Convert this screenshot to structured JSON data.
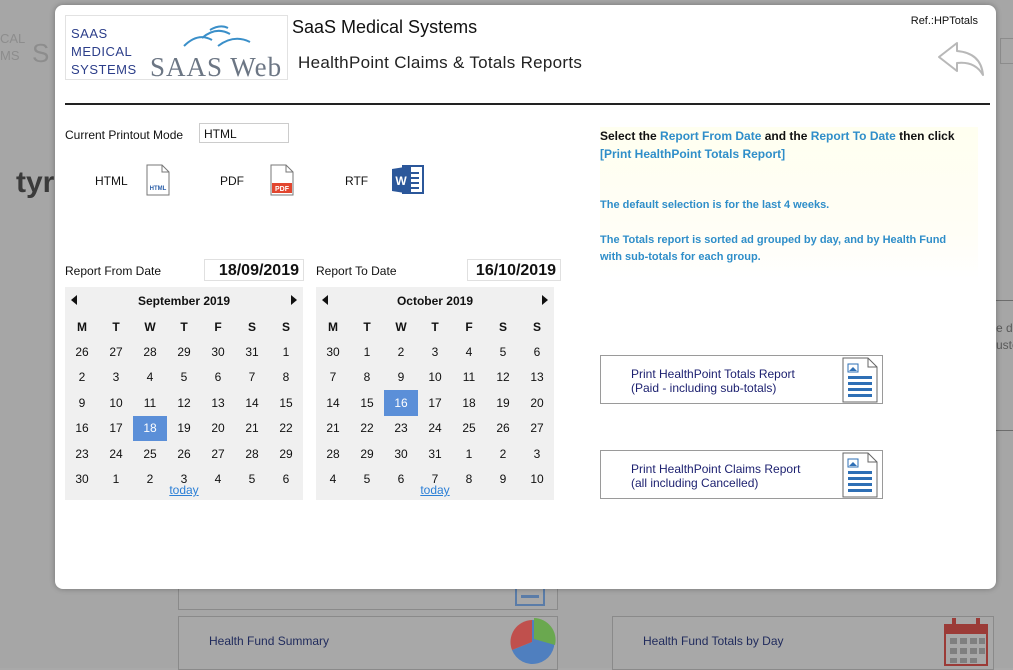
{
  "background": {
    "logo_line1": "CAL",
    "logo_line2": "MS",
    "logo_big": "S",
    "brand_partial": "tyr",
    "right_text_line1": "e d",
    "right_text_line2": "uste",
    "cards": [
      {
        "label": "Health Fund Summary"
      },
      {
        "label": "Health Fund Totals by Day"
      }
    ]
  },
  "header": {
    "logo_lines": [
      "SAAS",
      "MEDICAL",
      "SYSTEMS"
    ],
    "logo_web": "SAAS Web",
    "app_title": "SaaS Medical Systems",
    "report_title": "HealthPoint Claims & Totals Reports",
    "ref": "Ref.:HPTotals"
  },
  "printout": {
    "mode_label": "Current Printout Mode",
    "mode_value": "HTML",
    "formats": [
      {
        "label": "HTML",
        "icon": "html-file-icon"
      },
      {
        "label": "PDF",
        "icon": "pdf-file-icon"
      },
      {
        "label": "RTF",
        "icon": "word-file-icon"
      }
    ]
  },
  "from": {
    "label": "Report From Date",
    "value": "18/09/2019",
    "calendar": {
      "month": "September 2019",
      "weekdays": [
        "M",
        "T",
        "W",
        "T",
        "F",
        "S",
        "S"
      ],
      "weeks": [
        [
          "26",
          "27",
          "28",
          "29",
          "30",
          "31",
          "1"
        ],
        [
          "2",
          "3",
          "4",
          "5",
          "6",
          "7",
          "8"
        ],
        [
          "9",
          "10",
          "11",
          "12",
          "13",
          "14",
          "15"
        ],
        [
          "16",
          "17",
          "18",
          "19",
          "20",
          "21",
          "22"
        ],
        [
          "23",
          "24",
          "25",
          "26",
          "27",
          "28",
          "29"
        ],
        [
          "30",
          "1",
          "2",
          "3",
          "4",
          "5",
          "6"
        ]
      ],
      "selected": "18",
      "today": "today"
    }
  },
  "to": {
    "label": "Report To Date",
    "value": "16/10/2019",
    "calendar": {
      "month": "October 2019",
      "weekdays": [
        "M",
        "T",
        "W",
        "T",
        "F",
        "S",
        "S"
      ],
      "weeks": [
        [
          "30",
          "1",
          "2",
          "3",
          "4",
          "5",
          "6"
        ],
        [
          "7",
          "8",
          "9",
          "10",
          "11",
          "12",
          "13"
        ],
        [
          "14",
          "15",
          "16",
          "17",
          "18",
          "19",
          "20"
        ],
        [
          "21",
          "22",
          "23",
          "24",
          "25",
          "26",
          "27"
        ],
        [
          "28",
          "29",
          "30",
          "31",
          "1",
          "2",
          "3"
        ],
        [
          "4",
          "5",
          "6",
          "7",
          "8",
          "9",
          "10"
        ]
      ],
      "selected": "16",
      "today": "today"
    }
  },
  "info": {
    "p1_a": "Select the ",
    "p1_b": "Report From Date",
    "p1_c": " and the ",
    "p1_d": "Report To Date",
    "p1_e": " then click ",
    "p1_f": "[Print HealthPoint Totals Report]",
    "p2": "The default selection is for the last 4 weeks.",
    "p3": "The Totals report is sorted ad grouped by day, and by Health Fund with sub-totals for each group."
  },
  "buttons": {
    "totals_line1": "Print HealthPoint Totals Report",
    "totals_line2": "(Paid - including sub-totals)",
    "claims_line1": "Print HealthPoint Claims Report",
    "claims_line2": "(all including Cancelled)"
  },
  "colors": {
    "accent": "#2f8ec9",
    "selected_day": "#5b8fd8",
    "button_text": "#1b1f6f"
  }
}
